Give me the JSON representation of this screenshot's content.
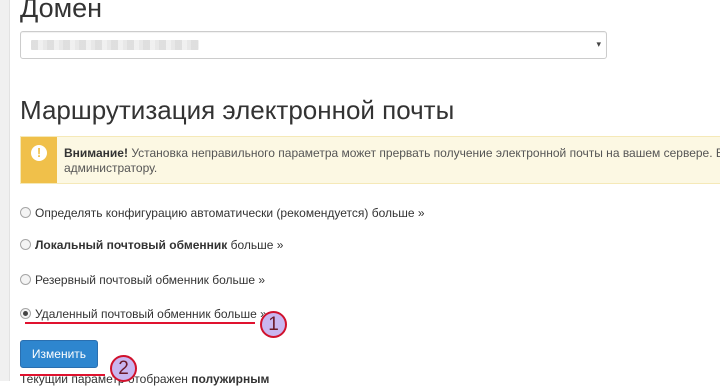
{
  "domain": {
    "title": "Домен",
    "select_arrow": "▾"
  },
  "routing": {
    "title": "Маршрутизация электронной почты"
  },
  "alert": {
    "icon": "exclamation-icon",
    "strong": "Внимание!",
    "text": " Установка неправильного параметра может прервать получение электронной почты на вашем сервере. Есл",
    "text_line2": "администратору."
  },
  "options": [
    {
      "label": "Определять конфигурацию автоматически (рекомендуется)",
      "more": " больше »",
      "bold": false,
      "selected": false
    },
    {
      "label": "Локальный почтовый обменник",
      "more": " больше »",
      "bold": true,
      "selected": false
    },
    {
      "label": "Резервный почтовый обменник",
      "more": " больше »",
      "bold": false,
      "selected": false
    },
    {
      "label": "Удаленный почтовый обменник",
      "more": " больше »",
      "bold": false,
      "selected": true
    }
  ],
  "change_button": "Изменить",
  "footnote": {
    "text": "Текущий параметр отображен ",
    "bold": "полужирным"
  },
  "annotations": {
    "badge1": "1",
    "badge2": "2"
  },
  "colors": {
    "button": "#2e86cf",
    "alert_bg": "#fcf8e3",
    "alert_accent": "#f0c04a",
    "annotation_red": "#e0122f",
    "badge_fill": "#c9b6f0"
  }
}
